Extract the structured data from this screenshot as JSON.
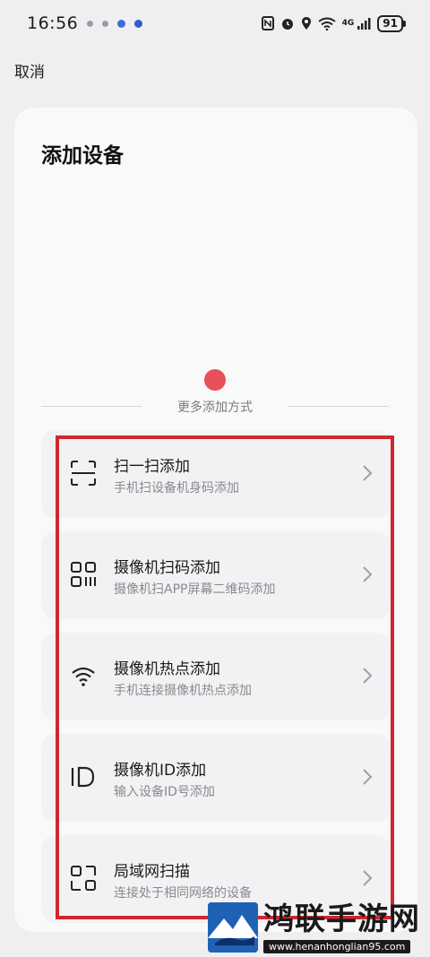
{
  "status_bar": {
    "time": "16:56",
    "network": "4G",
    "battery": "91"
  },
  "header": {
    "cancel_label": "取消"
  },
  "card": {
    "title": "添加设备",
    "more_methods_label": "更多添加方式",
    "methods": [
      {
        "title": "扫一扫添加",
        "subtitle": "手机扫设备机身码添加",
        "icon": "scan-frame-icon"
      },
      {
        "title": "摄像机扫码添加",
        "subtitle": "摄像机扫APP屏幕二维码添加",
        "icon": "qr-code-icon"
      },
      {
        "title": "摄像机热点添加",
        "subtitle": "手机连接摄像机热点添加",
        "icon": "wifi-icon"
      },
      {
        "title": "摄像机ID添加",
        "subtitle": "输入设备ID号添加",
        "icon": "id-icon"
      },
      {
        "title": "局域网扫描",
        "subtitle": "连接处于相同网络的设备",
        "icon": "lan-scan-icon"
      }
    ]
  },
  "watermark": {
    "name": "鸿联手游网",
    "url": "www.henanhonglian95.com"
  },
  "colors": {
    "highlight_box": "#d2262f",
    "pull_dot": "#e8505b",
    "background": "#efeff1"
  }
}
